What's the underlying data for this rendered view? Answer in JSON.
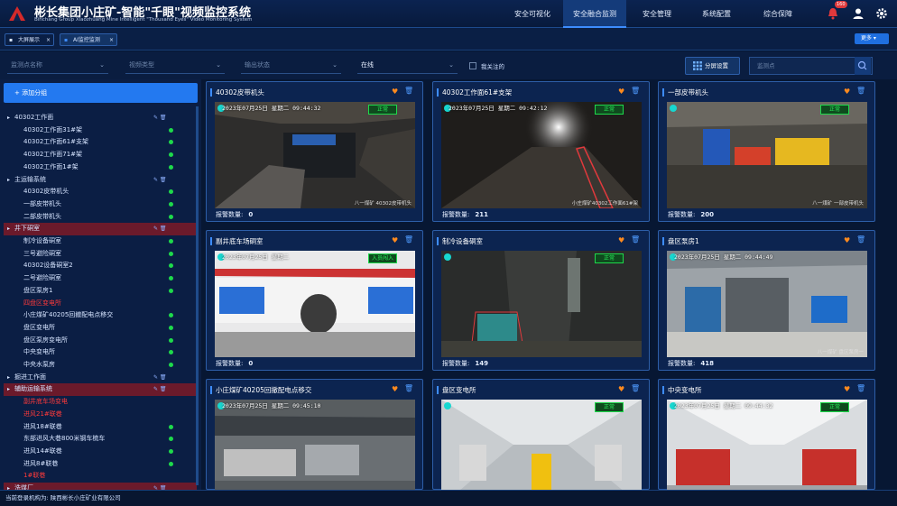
{
  "header": {
    "title": "彬长集团小庄矿-智能\"千眼\"视频监控系统",
    "subtitle": "Binchang Group Xiaozhuang Mine  Intelligent \"Thousand Eyes\" Video Monitoring System",
    "nav": [
      "安全可视化",
      "安全融合监测",
      "安全管理",
      "系统配置",
      "综合保障"
    ],
    "active_nav": "安全融合监测",
    "notification_count": "160"
  },
  "tabs": [
    {
      "label": "大屏展示",
      "close": "×"
    },
    {
      "label": "AI监控监测",
      "close": "×"
    }
  ],
  "more_label": "更多",
  "filters": {
    "location_placeholder": "监测点名称",
    "type_placeholder": "视频类型",
    "status_placeholder": "输出状态",
    "online_value": "在线",
    "my_focus_label": "我关注的",
    "split_label": "分屏设置",
    "search_placeholder": "监测点"
  },
  "sidebar": {
    "add_label": "+ 添加分组",
    "tree": [
      {
        "label": "40302工作面",
        "type": "group",
        "hl": false
      },
      {
        "label": "40302工作面31#架",
        "type": "item"
      },
      {
        "label": "40302工作面61#支架",
        "type": "item"
      },
      {
        "label": "40302工作面71#架",
        "type": "item"
      },
      {
        "label": "40302工作面1#架",
        "type": "item"
      },
      {
        "label": "主运输系统",
        "type": "group",
        "hl": false
      },
      {
        "label": "40302皮带机头",
        "type": "item"
      },
      {
        "label": "一部皮带机头",
        "type": "item"
      },
      {
        "label": "二部皮带机头",
        "type": "item"
      },
      {
        "label": "井下硐室",
        "type": "group",
        "hl": true
      },
      {
        "label": "制冷设备硐室",
        "type": "item"
      },
      {
        "label": "三号避险硐室",
        "type": "item"
      },
      {
        "label": "40302设备硐室2",
        "type": "item"
      },
      {
        "label": "二号避险硐室",
        "type": "item"
      },
      {
        "label": "盘区泵房1",
        "type": "item"
      },
      {
        "label": "四盘区变电所",
        "type": "item",
        "off": true
      },
      {
        "label": "小庄煤矿40205回撤配电点移交",
        "type": "item"
      },
      {
        "label": "盘区变电所",
        "type": "item"
      },
      {
        "label": "盘区泵房变电所",
        "type": "item"
      },
      {
        "label": "中央变电所",
        "type": "item"
      },
      {
        "label": "中央水泵房",
        "type": "item"
      },
      {
        "label": "掘进工作面",
        "type": "group",
        "hl": false
      },
      {
        "label": "辅助运输系统",
        "type": "group",
        "hl": true
      },
      {
        "label": "副井底车场变电",
        "type": "item",
        "off": true
      },
      {
        "label": "进风21#联巷",
        "type": "item",
        "off": true
      },
      {
        "label": "进风18#联巷",
        "type": "item"
      },
      {
        "label": "东部进风大巷800米钢车梳车",
        "type": "item"
      },
      {
        "label": "进风14#联巷",
        "type": "item"
      },
      {
        "label": "进风8#联巷",
        "type": "item"
      },
      {
        "label": "1#联巷",
        "type": "item",
        "off": true
      },
      {
        "label": "洗煤厂",
        "type": "group",
        "hl": true
      }
    ]
  },
  "alarm_label": "报警数量:",
  "cards": [
    {
      "title": "40302皮带机头",
      "alarm": "0",
      "osd": "2023年07月25日 星期二 09:44:32",
      "status": "正常",
      "caption": "八一煤矿 40302皮带机头"
    },
    {
      "title": "40302工作面61#支架",
      "alarm": "211",
      "osd": "2023年07月25日 星期二 09:42:12",
      "status": "正常",
      "caption": "小庄煤矿40302工作面61#架"
    },
    {
      "title": "一部皮带机头",
      "alarm": "200",
      "osd": "",
      "status": "正常",
      "caption": "八一煤矿 一部皮带机头"
    },
    {
      "title": "副井底车场硐室",
      "alarm": "0",
      "osd": "2023年07月25日 星期二",
      "status": "入员闯入",
      "caption": ""
    },
    {
      "title": "制冷设备硐室",
      "alarm": "149",
      "osd": "",
      "status": "正常",
      "caption": ""
    },
    {
      "title": "盘区泵房1",
      "alarm": "418",
      "osd": "2023年07月25日 星期二 09:44:49",
      "status": "",
      "caption": "八一煤矿 盘区泵房一"
    },
    {
      "title": "小庄煤矿40205回撤配电点移交",
      "alarm": "",
      "osd": "2023年07月25日 星期二 09:45:10",
      "status": "",
      "caption": ""
    },
    {
      "title": "盘区变电所",
      "alarm": "",
      "osd": "",
      "status": "正常",
      "caption": ""
    },
    {
      "title": "中央变电所",
      "alarm": "",
      "osd": "2023年07月25日 星期二 09:44:32",
      "status": "正常",
      "caption": ""
    }
  ],
  "footer": {
    "label": "当前登录机构为:",
    "org": "陕西彬长小庄矿业有限公司"
  },
  "colors": {
    "accent": "#3d8cff",
    "online": "#1ed94b",
    "offline": "#ff3a3a",
    "alarm": "#ff8a1e"
  },
  "icons": {
    "logo": "logo-icon",
    "bell": "bell-icon",
    "user": "user-icon",
    "gear": "gear-icon",
    "search": "search-icon"
  }
}
